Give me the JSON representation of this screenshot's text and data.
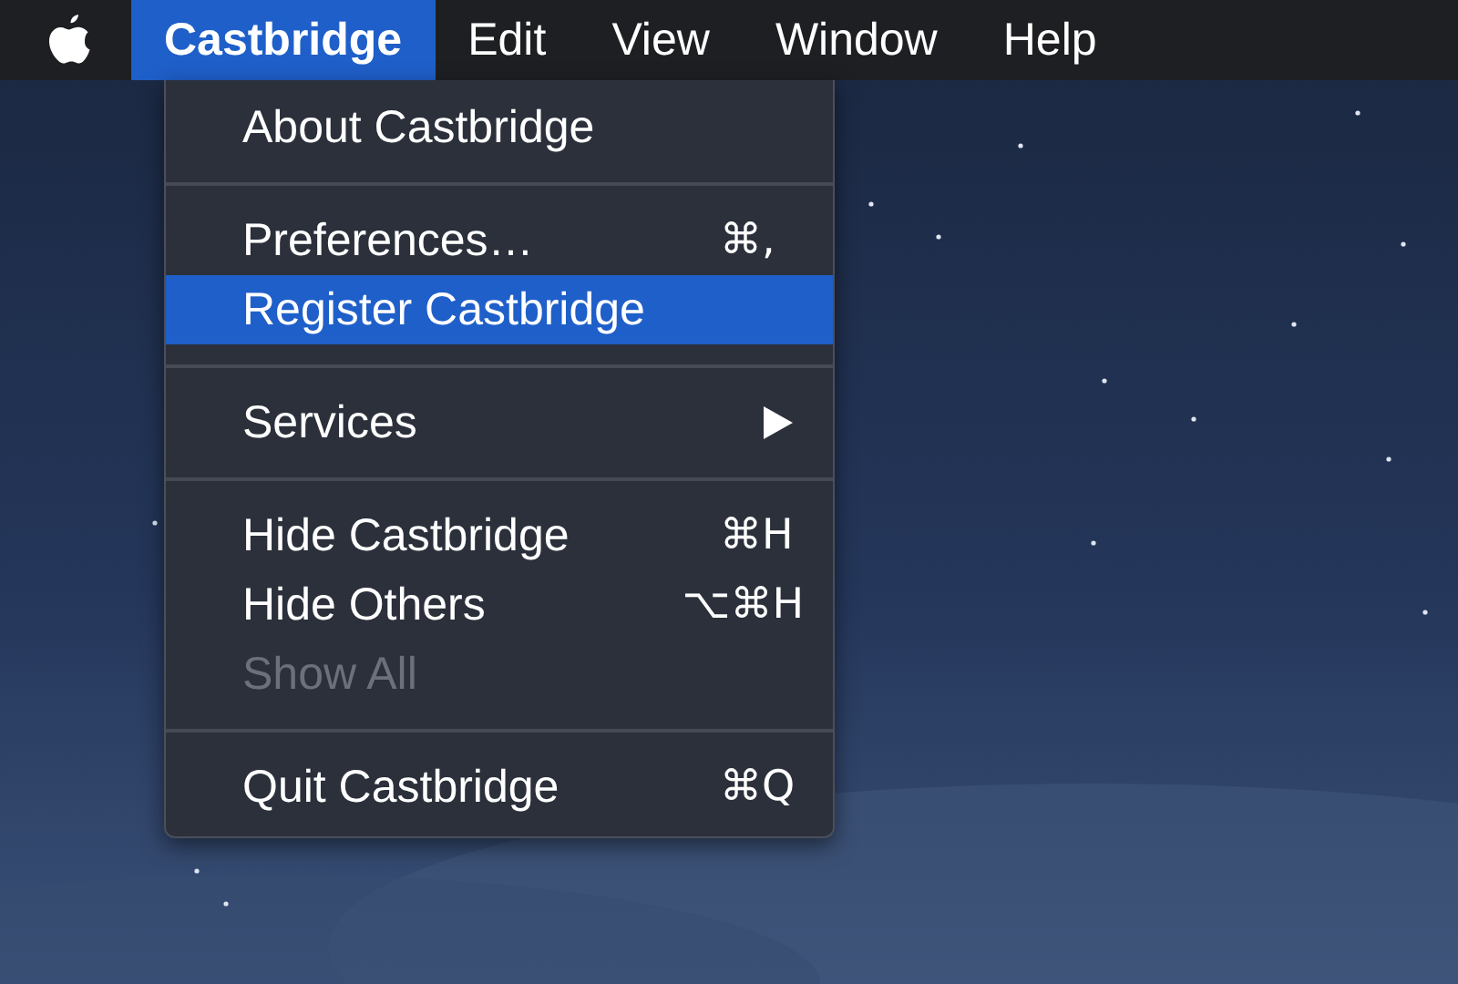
{
  "menu_bar": {
    "items": [
      {
        "label": "Castbridge",
        "selected": true
      },
      {
        "label": "Edit",
        "selected": false
      },
      {
        "label": "View",
        "selected": false
      },
      {
        "label": "Window",
        "selected": false
      },
      {
        "label": "Help",
        "selected": false
      }
    ]
  },
  "menu": {
    "items": [
      {
        "kind": "item",
        "label": "About Castbridge",
        "selected": false,
        "disabled": false,
        "submenu": false
      },
      {
        "kind": "separator"
      },
      {
        "kind": "item",
        "label": "Preferences…",
        "shortcut": "⌘,",
        "selected": false,
        "disabled": false,
        "submenu": false
      },
      {
        "kind": "item",
        "label": "Register Castbridge",
        "selected": true,
        "disabled": false,
        "submenu": false
      },
      {
        "kind": "separator"
      },
      {
        "kind": "item",
        "label": "Services",
        "selected": false,
        "disabled": false,
        "submenu": true
      },
      {
        "kind": "separator"
      },
      {
        "kind": "item",
        "label": "Hide Castbridge",
        "shortcut": "⌘H",
        "selected": false,
        "disabled": false,
        "submenu": false
      },
      {
        "kind": "item",
        "label": "Hide Others",
        "shortcut": "⌥⌘H",
        "selected": false,
        "disabled": false,
        "submenu": false
      },
      {
        "kind": "item",
        "label": "Show All",
        "selected": false,
        "disabled": true,
        "submenu": false
      },
      {
        "kind": "separator"
      },
      {
        "kind": "item",
        "label": "Quit Castbridge",
        "shortcut": "⌘Q",
        "selected": false,
        "disabled": false,
        "submenu": false
      }
    ]
  }
}
